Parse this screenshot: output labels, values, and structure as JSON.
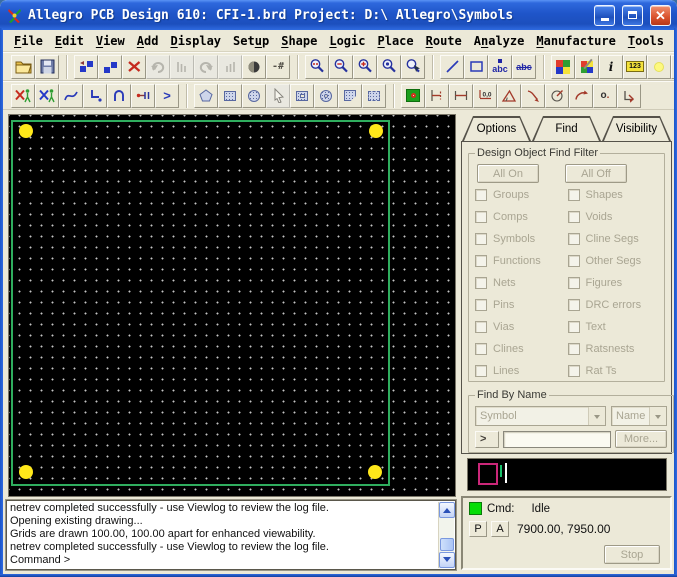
{
  "window": {
    "title": "Allegro PCB Design 610: CFI-1.brd  Project: D:\\ Allegro\\Symbols",
    "controls": {
      "minimize": "minimize",
      "maximize": "maximize",
      "close": "close"
    }
  },
  "colors": {
    "board_outline": "#2fae5e",
    "pad": "#ffe81a",
    "grid_dot": "#c4c4c4",
    "preview_outline": "#cb2779",
    "status_led": "#06dd06"
  },
  "menu": {
    "items": [
      {
        "label": "File",
        "u": 0
      },
      {
        "label": "Edit",
        "u": 0
      },
      {
        "label": "View",
        "u": 0
      },
      {
        "label": "Add",
        "u": 0
      },
      {
        "label": "Display",
        "u": 0
      },
      {
        "label": "Setup",
        "u": 3
      },
      {
        "label": "Shape",
        "u": 0
      },
      {
        "label": "Logic",
        "u": 0
      },
      {
        "label": "Place",
        "u": 0
      },
      {
        "label": "Route",
        "u": 0
      },
      {
        "label": "Analyze",
        "u": 1
      },
      {
        "label": "Manufacture",
        "u": 0
      },
      {
        "label": "Tools",
        "u": 0
      },
      {
        "label": "Help",
        "u": 0
      }
    ]
  },
  "toolbars": {
    "row1": [
      [
        {
          "icon": "open-folder-icon"
        },
        {
          "icon": "save-icon"
        }
      ],
      [
        {
          "icon": "paste-icon"
        },
        {
          "icon": "copy-icon"
        },
        {
          "icon": "delete-icon"
        },
        {
          "icon": "undo-icon",
          "disabled": true
        },
        {
          "icon": "undo-list-icon",
          "disabled": true
        },
        {
          "icon": "redo-icon",
          "disabled": true
        },
        {
          "icon": "redo-list-icon",
          "disabled": true
        },
        {
          "icon": "shadow-mode-icon"
        },
        {
          "icon": "unfix-icon"
        }
      ],
      [
        {
          "icon": "zoom-points-icon"
        },
        {
          "icon": "zoom-out-icon"
        },
        {
          "icon": "zoom-in-icon"
        },
        {
          "icon": "zoom-fit-icon"
        },
        {
          "icon": "zoom-previous-icon"
        }
      ],
      [
        {
          "icon": "add-line-icon"
        },
        {
          "icon": "add-rect-icon"
        },
        {
          "icon": "add-text-icon"
        },
        {
          "icon": "edit-text-icon"
        }
      ],
      [
        {
          "icon": "color-dialog-icon"
        },
        {
          "icon": "color-edit-icon"
        },
        {
          "icon": "info-icon"
        },
        {
          "icon": "measure-icon"
        },
        {
          "icon": "highlight-icon"
        },
        {
          "icon": "dehighlight-icon"
        }
      ]
    ],
    "row2": [
      [
        {
          "icon": "slide-icon"
        },
        {
          "icon": "shove-icon"
        },
        {
          "icon": "add-connect-icon"
        },
        {
          "icon": "route-corner-icon"
        },
        {
          "icon": "route-bubble-icon"
        },
        {
          "icon": "pin-escape-icon"
        },
        {
          "icon": "next-icon"
        }
      ],
      [
        {
          "icon": "shape-add-icon"
        },
        {
          "icon": "shape-rect-icon"
        },
        {
          "icon": "shape-circle-icon"
        },
        {
          "icon": "select-shape-icon",
          "disabled": true
        },
        {
          "icon": "shape-void-rect-icon"
        },
        {
          "icon": "shape-void-circle-icon"
        },
        {
          "icon": "shape-edit-icon"
        },
        {
          "icon": "shape-delete-icon"
        }
      ],
      [
        {
          "icon": "label-tune-icon"
        },
        {
          "icon": "dim-linear-icon"
        },
        {
          "icon": "dim-vertical-icon"
        },
        {
          "icon": "dim-datum-icon"
        },
        {
          "icon": "dim-angle-icon"
        },
        {
          "icon": "dim-leader-icon"
        },
        {
          "icon": "dim-radius-icon"
        },
        {
          "icon": "dim-arc-icon"
        },
        {
          "icon": "dim-diameter-icon"
        },
        {
          "icon": "dim-pick-icon"
        }
      ]
    ]
  },
  "tabs": {
    "items": [
      "Options",
      "Find",
      "Visibility"
    ],
    "active": "Find"
  },
  "find_filter": {
    "title": "Design Object Find Filter",
    "all_on": "All On",
    "all_off": "All Off",
    "left_column": [
      "Groups",
      "Comps",
      "Symbols",
      "Functions",
      "Nets",
      "Pins",
      "Vias",
      "Clines",
      "Lines"
    ],
    "right_column": [
      "Shapes",
      "Voids",
      "Cline Segs",
      "Other Segs",
      "Figures",
      "DRC errors",
      "Text",
      "Ratsnests",
      "Rat Ts"
    ]
  },
  "find_by_name": {
    "title": "Find By Name",
    "category_value": "Symbol",
    "mode_value": "Name",
    "prompt": ">",
    "input_value": "",
    "more_label": "More..."
  },
  "status": {
    "cmd_label": "Cmd:",
    "cmd_value": "Idle",
    "pick_button": "P",
    "abs_button": "A",
    "coordinates": "7900.00, 7950.00",
    "stop_label": "Stop"
  },
  "console": {
    "lines": [
      "netrev completed successfully - use Viewlog to review the log file.",
      "Opening existing drawing...",
      "Grids are drawn 100.00, 100.00 apart for enhanced viewability.",
      "netrev completed successfully - use Viewlog to review the log file.",
      "Command >"
    ]
  }
}
